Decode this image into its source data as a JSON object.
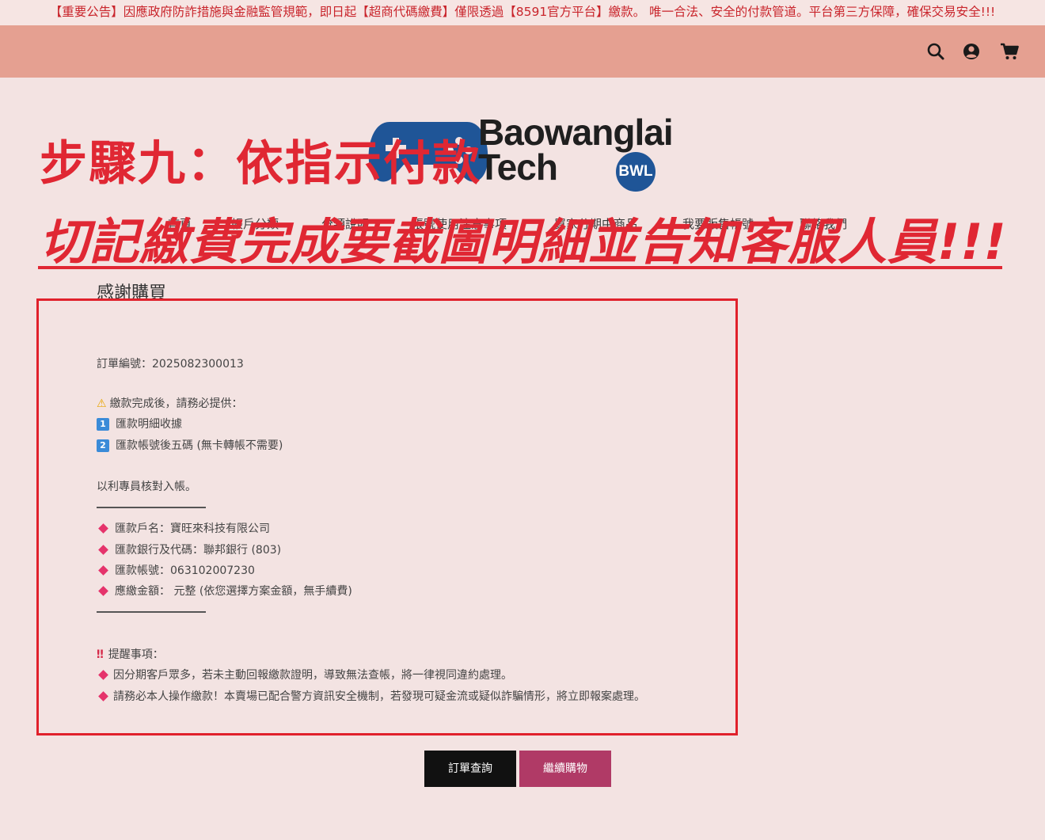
{
  "announcement": "【重要公告】因應政府防詐措施與金融監管規範，即日起【超商代碼繳費】僅限透過【8591官方平台】繳款。 唯一合法、安全的付款管道。平台第三方保障，確保交易安全!!!",
  "header": {
    "icons": [
      "search-icon",
      "user-icon",
      "cart-icon"
    ]
  },
  "logo": {
    "line1": "Baowanglai",
    "line2": "Tech",
    "badge": "BWL"
  },
  "overlay": {
    "step_title": "步驟九：依指示付款",
    "warning": "切記繳費完成要截圖明細並告知客服人員!!!"
  },
  "nav": {
    "items": [
      "首頁",
      "帳戶分類",
      "分類說明",
      "帳號使用注意事項",
      "買家分期中商品",
      "我要販售帳號",
      "聯絡我們"
    ]
  },
  "page": {
    "title": "感謝購買"
  },
  "order": {
    "number_line": "訂單編號：2025082300013",
    "notice_heading": "繳款完成後，請務必提供：",
    "notice_items": [
      "匯款明細收據",
      "匯款帳號後五碼 (無卡轉帳不需要)"
    ],
    "notice_numbers": [
      "1",
      "2"
    ],
    "purpose": "以利專員核對入帳。",
    "bank": {
      "account_name": "匯款戶名：寶旺來科技有限公司",
      "bank_code": "匯款銀行及代碼：聯邦銀行 (803)",
      "account_number": "匯款帳號：063102007230",
      "amount": "應繳金額： 元整 (依您選擇方案金額，無手續費)"
    },
    "reminder_heading": "提醒事項：",
    "reminders": [
      "因分期客戶眾多，若未主動回報繳款證明，導致無法查帳，將一律視同違約處理。",
      "請務必本人操作繳款！本賣場已配合警方資訊安全機制，若發現可疑金流或疑似詐騙情形，將立即報案處理。"
    ]
  },
  "buttons": {
    "order_query": "訂單查詢",
    "continue_shopping": "繼續購物"
  },
  "colors": {
    "header_bg": "#e5a091",
    "page_bg": "#f3e3e2",
    "alert_red": "#e02733",
    "button_dark": "#111111",
    "button_accent": "#b03a66"
  }
}
